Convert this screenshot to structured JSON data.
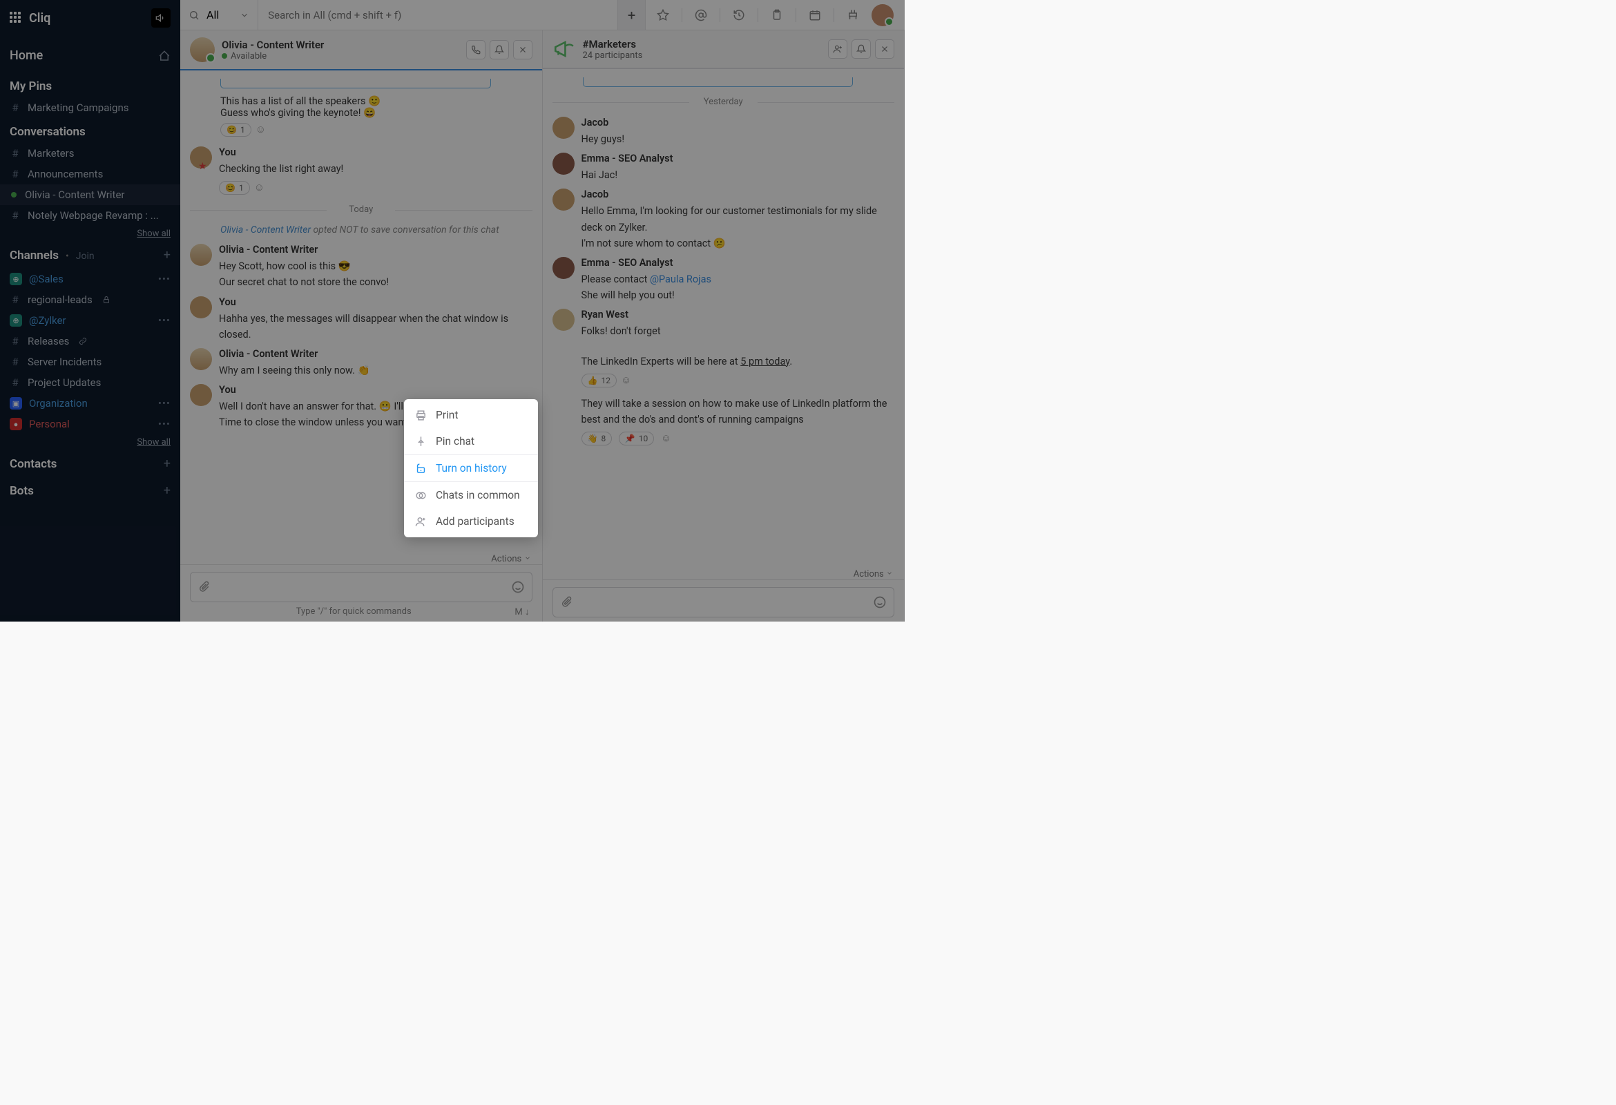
{
  "brand": "Cliq",
  "sidebar": {
    "home": "Home",
    "pins_header": "My Pins",
    "pins": [
      {
        "label": "Marketing Campaigns"
      }
    ],
    "convo_header": "Conversations",
    "convos": [
      {
        "label": "Marketers"
      },
      {
        "label": "Announcements"
      },
      {
        "label": "Olivia - Content Writer"
      },
      {
        "label": "Notely Webpage Revamp : ..."
      }
    ],
    "show_all": "Show all",
    "channels_header": "Channels",
    "join": "Join",
    "channels": [
      {
        "label": "@Sales"
      },
      {
        "label": "regional-leads"
      },
      {
        "label": "@Zylker"
      },
      {
        "label": "Releases"
      },
      {
        "label": "Server Incidents"
      },
      {
        "label": "Project Updates"
      },
      {
        "label": "Organization"
      },
      {
        "label": "Personal"
      }
    ],
    "contacts_header": "Contacts",
    "bots_header": "Bots"
  },
  "topbar": {
    "scope": "All",
    "search_placeholder": "Search in All (cmd + shift + f)"
  },
  "left_panel": {
    "title": "Olivia - Content Writer",
    "status": "Available",
    "messages": {
      "m1a": "This has a list of all the speakers  🙂",
      "m1b": "Guess who's giving the keynote!  😄",
      "r1": "1",
      "m2_who": "You",
      "m2": "Checking  the list right away!",
      "r2": "1",
      "divider": "Today",
      "sys_who": "Olivia - Content Writer",
      "sys_txt": " opted NOT to save conversation for this chat",
      "m3_who": "Olivia - Content Writer",
      "m3a": "Hey Scott, how cool is this  😎",
      "m3b": "Our secret chat to not store the convo!",
      "m4_who": "You",
      "m4": "Hahha yes, the messages will disappear when the chat window is closed.",
      "m5_who": "Olivia - Content Writer",
      "m5": "Why am I seeing this only now.  👏",
      "m6_who": "You",
      "m6": "Well I don't have an answer for that.  😬 I'll revert back to normal mode. Time to close the window unless you want to loose them."
    },
    "actions": "Actions",
    "hint": "Type \"/\" for quick commands",
    "mode": "M ↓"
  },
  "right_panel": {
    "title": "#Marketers",
    "sub": "24 participants",
    "divider": "Yesterday",
    "messages": {
      "m1_who": "Jacob",
      "m1": "Hey guys!",
      "m2_who": "Emma - SEO Analyst",
      "m2": "Hai Jac!",
      "m3_who": "Jacob",
      "m3a": "Hello Emma, I'm looking for our customer testimonials for my slide deck on Zylker.",
      "m3b": " I'm not sure whom to contact  😕",
      "m4_who": "Emma - SEO Analyst",
      "m4a": "Please contact ",
      "m4_mention": "@Paula Rojas",
      "m4b": " She will help you out!",
      "m5_who": "Ryan West",
      "m5a": "Folks! don't forget",
      "m5b_pre": "The LinkedIn Experts will be here at ",
      "m5b_time": "5 pm today",
      "m5b_post": ".",
      "r5": "12",
      "m5c": "They will take a session on how to make use of LinkedIn platform the best and the do's and dont's of running campaigns",
      "r6a": "8",
      "r6b": "10"
    },
    "actions": "Actions"
  },
  "ctx": {
    "print": "Print",
    "pin": "Pin chat",
    "history": "Turn on history",
    "common": "Chats in common",
    "add": "Add participants"
  }
}
